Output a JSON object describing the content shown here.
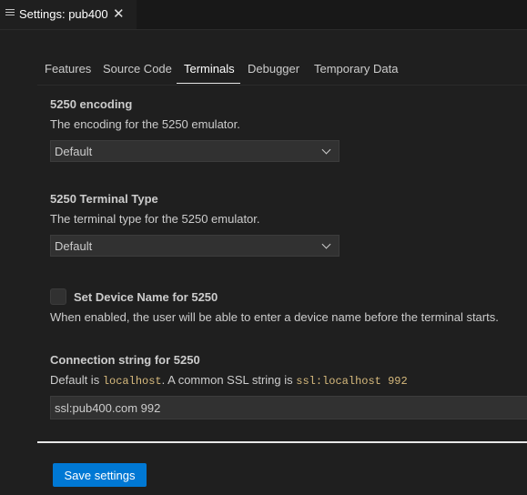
{
  "tab": {
    "title": "Settings: pub400",
    "close_glyph": "✕",
    "icon": "settings-file-icon"
  },
  "subtabs": [
    {
      "label": "Features"
    },
    {
      "label": "Source Code"
    },
    {
      "label": "Terminals",
      "active": true
    },
    {
      "label": "Debugger"
    },
    {
      "label": "Temporary Data"
    }
  ],
  "settings": {
    "encoding": {
      "title": "5250 encoding",
      "description": "The encoding for the 5250 emulator.",
      "value": "Default"
    },
    "terminal_type": {
      "title": "5250 Terminal Type",
      "description": "The terminal type for the 5250 emulator.",
      "value": "Default"
    },
    "device_name": {
      "title": "Set Device Name for 5250",
      "description": "When enabled, the user will be able to enter a device name before the terminal starts.",
      "checked": false
    },
    "connection_string": {
      "title": "Connection string for 5250",
      "desc_prefix": "Default is ",
      "desc_code1": "localhost",
      "desc_middle": ". A common SSL string is ",
      "desc_code2": "ssl:localhost 992",
      "value": "ssl:pub400.com 992"
    }
  },
  "footer": {
    "save_label": "Save settings"
  },
  "colors": {
    "accent": "#0078d4",
    "code": "#d7ba7d",
    "background": "#1f1f1f"
  }
}
